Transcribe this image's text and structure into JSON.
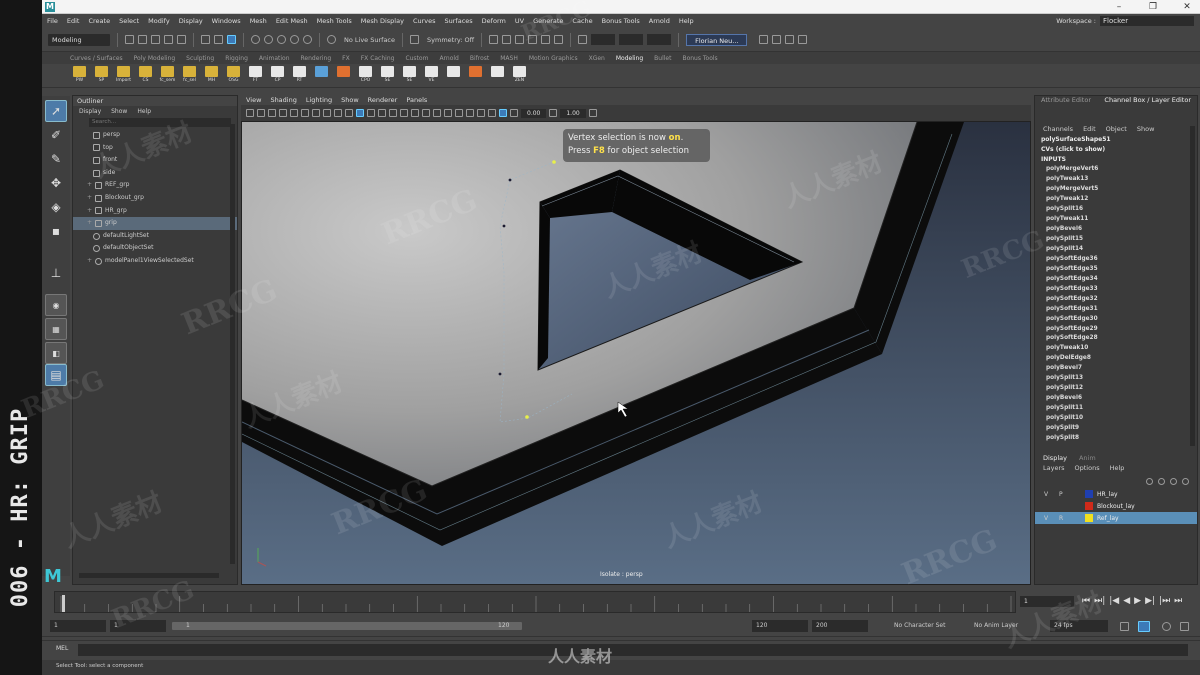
{
  "side_title": "006 - HR: GRIP",
  "app": {
    "logo": "M"
  },
  "window_controls": {
    "minimize": "–",
    "maximize": "❐",
    "close": "✕"
  },
  "menubar": {
    "items": [
      "File",
      "Edit",
      "Create",
      "Select",
      "Modify",
      "Display",
      "Windows",
      "Mesh",
      "Edit Mesh",
      "Mesh Tools",
      "Mesh Display",
      "Curves",
      "Surfaces",
      "Deform",
      "UV",
      "Generate",
      "Cache",
      "Bonus Tools",
      "Arnold",
      "Help"
    ],
    "workspace_label": "Workspace :",
    "workspace_value": "Flocker"
  },
  "statusline": {
    "mode": "Modeling",
    "live_surface": "No Live Surface",
    "symmetry": "Symmetry: Off",
    "user": "Florian Neu..."
  },
  "shelf": {
    "tabs": [
      "Curves / Surfaces",
      "Poly Modeling",
      "Sculpting",
      "Rigging",
      "Animation",
      "Rendering",
      "FX",
      "FX Caching",
      "Custom",
      "Arnold",
      "Bifrost",
      "MASH",
      "Motion Graphics",
      "XGen",
      "Modeling",
      "Bullet",
      "Bonus Tools"
    ],
    "active_tab": "Modeling",
    "buttons": [
      {
        "label": "PW",
        "color": "#d8b23a"
      },
      {
        "label": "SP",
        "color": "#d8b23a"
      },
      {
        "label": "Import",
        "color": "#d8b23a"
      },
      {
        "label": "CS",
        "color": "#d8b23a"
      },
      {
        "label": "fc_sem",
        "color": "#d8b23a"
      },
      {
        "label": "fc_sel",
        "color": "#d8b23a"
      },
      {
        "label": "MH",
        "color": "#d8b23a"
      },
      {
        "label": "OSG",
        "color": "#d8b23a"
      },
      {
        "label": "FT",
        "color": "#e8e8e8"
      },
      {
        "label": "CP",
        "color": "#e8e8e8"
      },
      {
        "label": "RT",
        "color": "#e8e8e8"
      },
      {
        "label": "",
        "color": "#5aa0d8"
      },
      {
        "label": "",
        "color": "#e07030"
      },
      {
        "label": "CPO",
        "color": "#e8e8e8"
      },
      {
        "label": "SE",
        "color": "#e8e8e8"
      },
      {
        "label": "SE",
        "color": "#e8e8e8"
      },
      {
        "label": "VE",
        "color": "#e8e8e8"
      },
      {
        "label": "",
        "color": "#e8e8e8"
      },
      {
        "label": "",
        "color": "#e07030"
      },
      {
        "label": "",
        "color": "#e8e8e8"
      },
      {
        "label": "ZEN",
        "color": "#e8e8e8"
      }
    ]
  },
  "outliner": {
    "title": "Outliner",
    "menus": [
      "Display",
      "Show",
      "Help"
    ],
    "search_placeholder": "Search...",
    "items": [
      {
        "label": "persp",
        "indent": 20,
        "icon": "camera-icon",
        "sel": false
      },
      {
        "label": "top",
        "indent": 20,
        "icon": "camera-icon",
        "sel": false
      },
      {
        "label": "front",
        "indent": 20,
        "icon": "camera-icon",
        "sel": false
      },
      {
        "label": "side",
        "indent": 20,
        "icon": "camera-icon",
        "sel": false
      },
      {
        "label": "REF_grp",
        "indent": 14,
        "icon": "group-icon",
        "sel": false,
        "plus": "+"
      },
      {
        "label": "Blockout_grp",
        "indent": 14,
        "icon": "group-icon",
        "sel": false,
        "plus": "+"
      },
      {
        "label": "HR_grp",
        "indent": 14,
        "icon": "group-icon",
        "sel": false,
        "plus": "+"
      },
      {
        "label": "grip",
        "indent": 14,
        "icon": "group-icon",
        "sel": true,
        "plus": "+"
      },
      {
        "label": "defaultLightSet",
        "indent": 20,
        "icon": "set-icon",
        "sel": false
      },
      {
        "label": "defaultObjectSet",
        "indent": 20,
        "icon": "set-icon",
        "sel": false
      },
      {
        "label": "modelPanel1ViewSelectedSet",
        "indent": 14,
        "icon": "set-icon",
        "sel": false,
        "plus": "+"
      }
    ]
  },
  "viewport": {
    "menus": [
      "View",
      "Shading",
      "Lighting",
      "Show",
      "Renderer",
      "Panels"
    ],
    "exposure": "0.00",
    "gamma": "1.00",
    "hud_line1_a": "Vertex selection is now ",
    "hud_line1_b": "on",
    "hud_line1_c": ".",
    "hud_line2_a": "Press ",
    "hud_line2_b": "F8",
    "hud_line2_c": " for object selection",
    "camera_label": "Isolate : persp"
  },
  "channelbox": {
    "tab_attr": "Attribute Editor",
    "tab_cb": "Channel Box / Layer Editor",
    "menus": [
      "Channels",
      "Edit",
      "Object",
      "Show"
    ],
    "shape": "polySurfaceShape51",
    "cvs": "CVs (click to show)",
    "inputs_label": "INPUTS",
    "inputs": [
      "polyMergeVert6",
      "polyTweak13",
      "polyMergeVert5",
      "polyTweak12",
      "polySplit16",
      "polyTweak11",
      "polyBevel6",
      "polySplit15",
      "polySplit14",
      "polySoftEdge36",
      "polySoftEdge35",
      "polySoftEdge34",
      "polySoftEdge33",
      "polySoftEdge32",
      "polySoftEdge31",
      "polySoftEdge30",
      "polySoftEdge29",
      "polySoftEdge28",
      "polyTweak10",
      "polyDelEdge8",
      "polyBevel7",
      "polySplit13",
      "polySplit12",
      "polyBevel6",
      "polySplit11",
      "polySplit10",
      "polySplit9",
      "polySplit8"
    ]
  },
  "layers": {
    "tabs": [
      "Display",
      "Anim"
    ],
    "menus": [
      "Layers",
      "Options",
      "Help"
    ],
    "col_v": "V",
    "col_p": "P",
    "items": [
      {
        "name": "HR_lay",
        "color": "#1f3fb0",
        "sel": false,
        "v": "",
        "p": ""
      },
      {
        "name": "Blockout_lay",
        "color": "#d02a1a",
        "sel": false,
        "v": "",
        "p": ""
      },
      {
        "name": "Ref_lay",
        "color": "#f0e020",
        "sel": true,
        "v": "V",
        "p": "R"
      }
    ]
  },
  "timeline": {
    "current_frame": "1",
    "playback": [
      "⏮",
      "⏭|",
      "|◀",
      "◀",
      "▶",
      "▶|",
      "|⏭",
      "⏭"
    ]
  },
  "range": {
    "start": "1",
    "inner_start": "1",
    "handle_start": "1",
    "handle_end": "120",
    "end": "120",
    "end2": "200",
    "character_set": "No Character Set",
    "anim_layer": "No Anim Layer",
    "fps": "24 fps"
  },
  "cmdline": {
    "label": "MEL"
  },
  "helpline": {
    "text": "Select Tool: select a component"
  },
  "watermarks": {
    "a": "RRCG",
    "b": "人人素材",
    "footer": "人人素材"
  },
  "maya_logo": "M"
}
